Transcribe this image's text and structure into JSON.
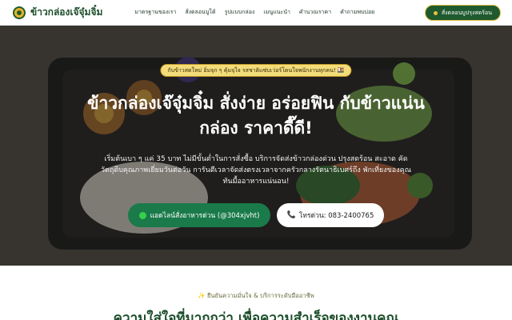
{
  "brand": {
    "name": "ข้าวกล่องเจ๊จุ๋มจิ๋ม",
    "logo_icon": "brand-logo-icon"
  },
  "nav": {
    "links": [
      "มาตรฐานของเรา",
      "สั่งตลอนบูโต้",
      "รูปแบบกล่อง",
      "เมนูแนะนำ",
      "คำนวณราคา",
      "คำถามพบบ่อย"
    ],
    "cta_label": "สั่งตลอนบูปรุงสดร้อน"
  },
  "hero": {
    "badge": "กับข้าวสดใหม่ อิ่มจุก ๆ คุ้มจุใจ รสชาติแซ่บเว่อร์โดนใจพนักงานทุกคน! 🍱",
    "title": "ข้าวกล่องเจ๊จุ๋มจิ๋ม สั่งง่าย อร่อยฟิน กับข้าวแน่นกล่อง ราคาดี๊ดี!",
    "description": "เริ่มต้นเบา ๆ แค่ 35 บาท ไม่มีขั้นต่ำในการสั่งซื้อ บริการจัดส่งข้าวกล่องด่วน ปรุงสดร้อน สะอาด คัดวัตถุดิบคุณภาพเยี่ยมวันต่อวัน การันตีเวลาจัดส่งตรงเวลาจากครัวกลางรัตนาธิเบศร์ถึง พักเที่ยงของคุณทันมื้ออาหารแน่นอน!",
    "line_button": "แอดไลน์สั่งอาหารด่วน (@304xjvht)",
    "phone_button": "โทรด่วน: 083-2400765"
  },
  "section": {
    "tag": "✨ ยืนยันความมั่นใจ & บริการระดับมืออาชีพ",
    "heading": "ความใส่ใจที่มากกว่า เพื่อความสำเร็จของงานคุณ"
  },
  "colors": {
    "primary": "#1f5a2e",
    "accent": "#e8c042",
    "line_green": "#1a7a4a"
  }
}
